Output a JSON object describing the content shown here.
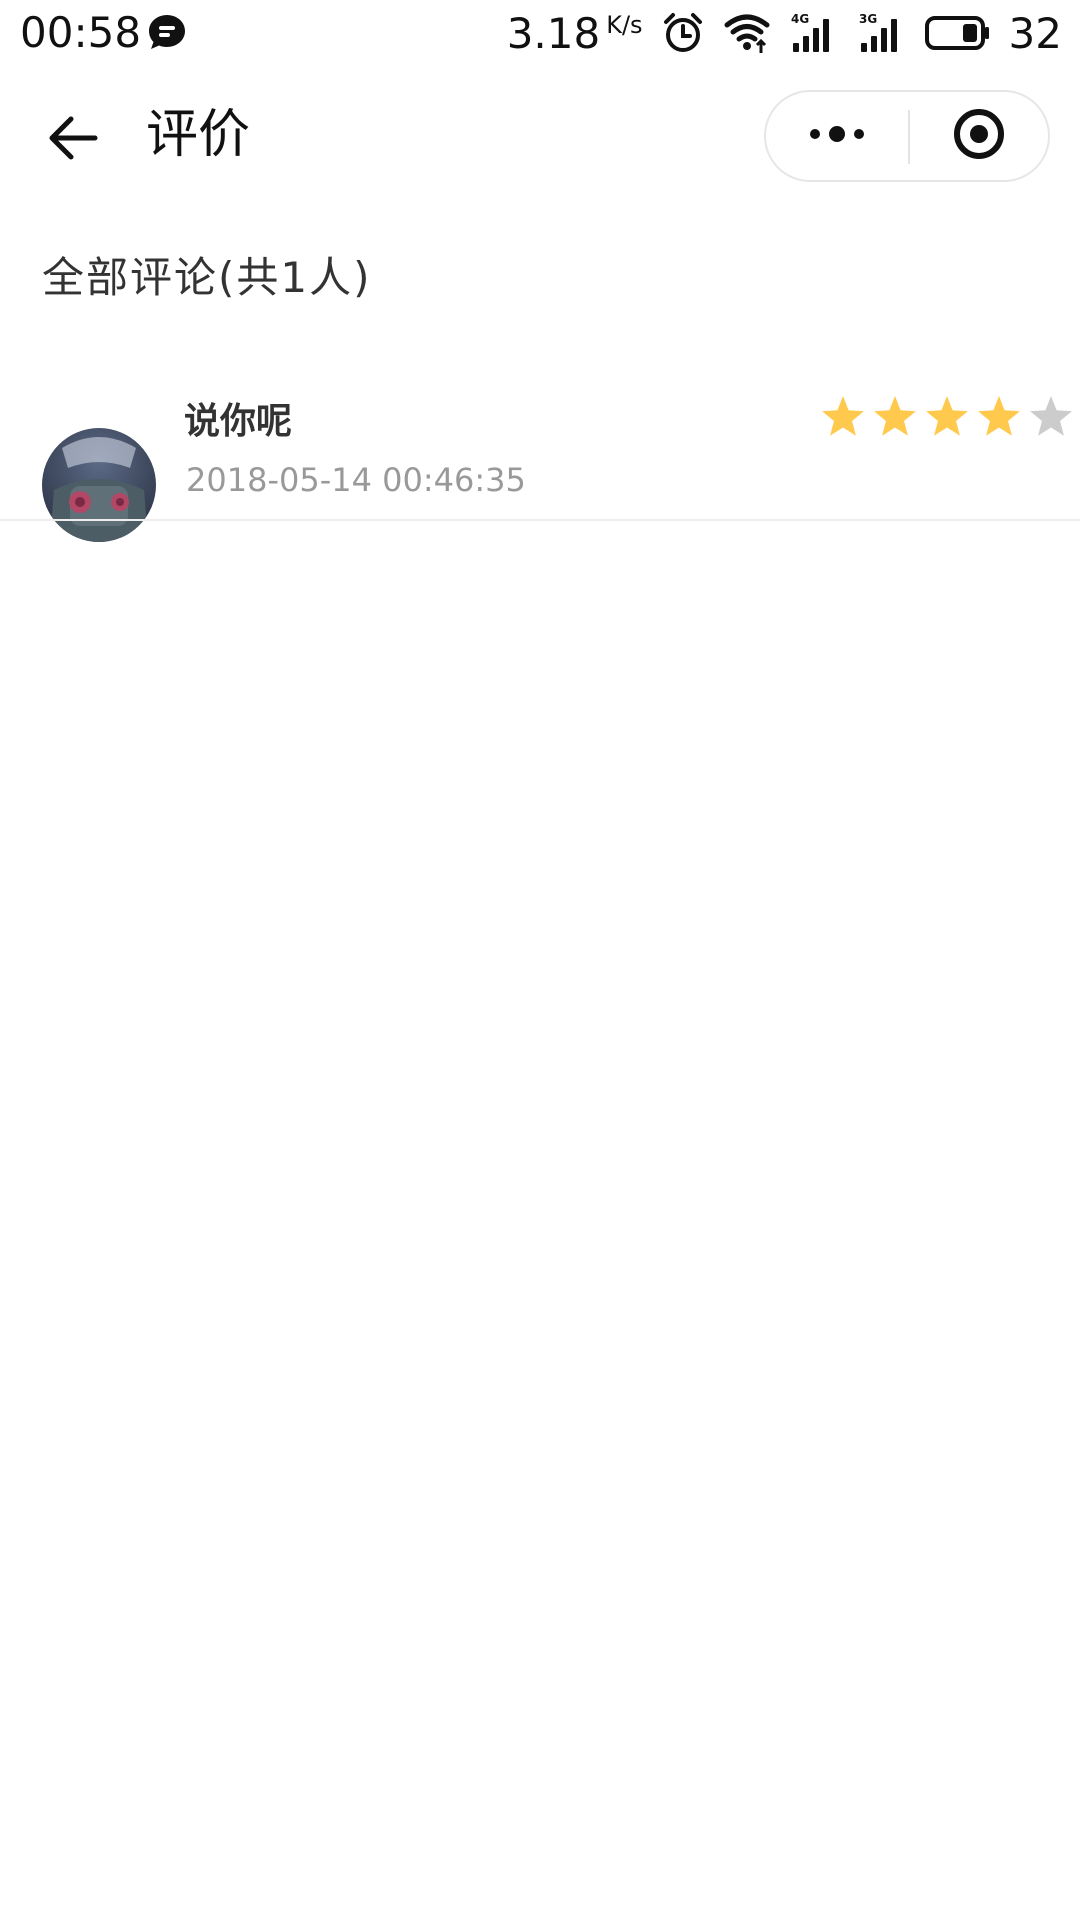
{
  "status_bar": {
    "time": "00:58",
    "speed_value": "3.18",
    "speed_unit": "K/s",
    "battery_level": "32",
    "icons": [
      "message-bubble-icon",
      "alarm-icon",
      "wifi-icon",
      "signal-4g-icon",
      "signal-3g-icon",
      "battery-icon"
    ]
  },
  "nav": {
    "title": "评价",
    "back_icon": "arrow-left-icon",
    "more_icon": "more-dots-icon",
    "close_icon": "target-circle-icon"
  },
  "section": {
    "header": "全部评论(共1人)"
  },
  "comments": [
    {
      "name": "说你呢",
      "time": "2018-05-14 00:46:35",
      "rating": 4,
      "max_rating": 5
    }
  ],
  "colors": {
    "star_filled": "#FFC94D",
    "star_empty": "#CCCCCC",
    "divider": "#EEEEEE",
    "secondary_text": "#999999"
  }
}
